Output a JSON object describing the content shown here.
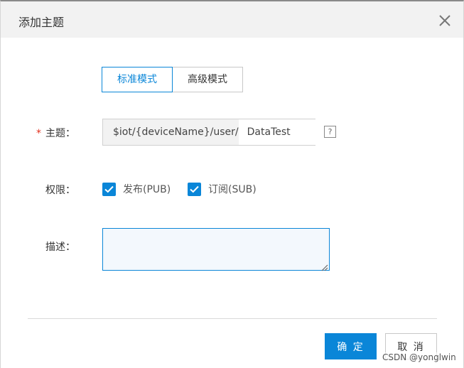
{
  "dialog": {
    "title": "添加主题"
  },
  "mode_tabs": [
    {
      "label": "标准模式",
      "active": true
    },
    {
      "label": "高级模式",
      "active": false
    }
  ],
  "topic": {
    "label": "主题：",
    "required_mark": "*",
    "prefix": "$iot/{deviceName}/user/",
    "value": "DataTest"
  },
  "permissions": {
    "label": "权限：",
    "options": [
      {
        "label": "发布(PUB)",
        "checked": true
      },
      {
        "label": "订阅(SUB)",
        "checked": true
      }
    ]
  },
  "description": {
    "label": "描述：",
    "value": ""
  },
  "footer": {
    "ok_label": "确 定",
    "cancel_label": "取 消"
  },
  "watermark": "CSDN @yonglwin",
  "colors": {
    "accent": "#0a86d8",
    "required": "#e3311e",
    "header_bg": "#f2f2f2"
  }
}
